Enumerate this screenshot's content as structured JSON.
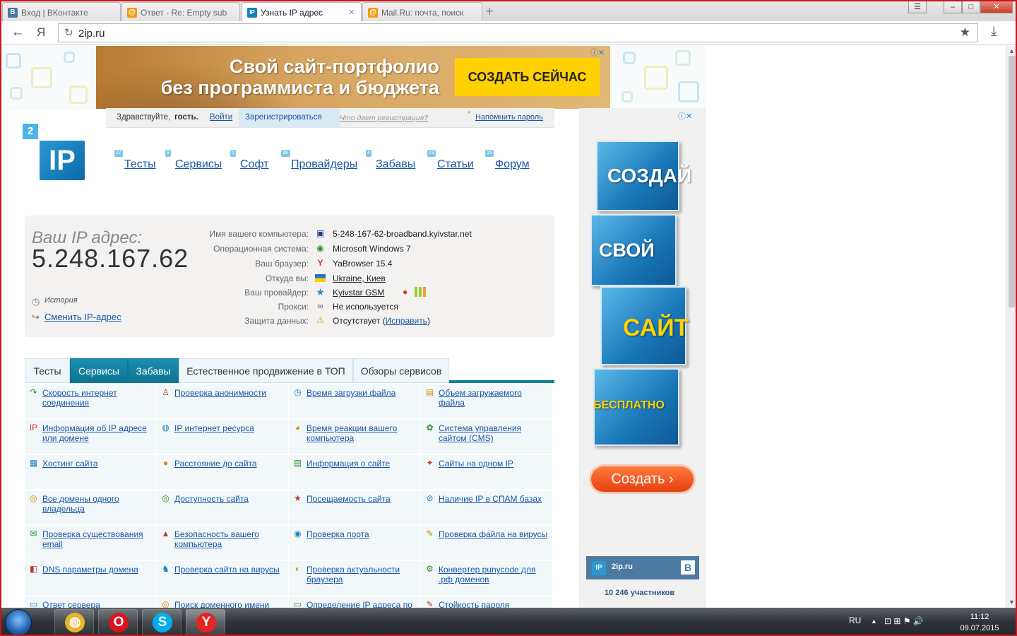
{
  "browser": {
    "tabs": [
      {
        "title": "Вход | ВКонтакте",
        "favicon": "В",
        "color": "#4c75a3"
      },
      {
        "title": "Ответ - Re: Empty sub",
        "favicon": "@",
        "color": "#f39c12"
      },
      {
        "title": "Узнать IP адрес",
        "favicon": "IP",
        "color": "#1a7fc1"
      },
      {
        "title": "Mail.Ru: почта, поиск",
        "favicon": "@",
        "color": "#f39c12"
      }
    ],
    "close_glyph": "×",
    "new_tab_glyph": "+",
    "url": "2ip.ru",
    "back_glyph": "←",
    "yandex_glyph": "Я",
    "reload_glyph": "↻",
    "star_glyph": "★",
    "download_glyph": "⤓",
    "win_menu": "☰",
    "win_min": "–",
    "win_max": "□",
    "win_close": "✕"
  },
  "banner": {
    "line1": "Свой сайт-портфолио",
    "line2": "без программиста и бюджета",
    "cta": "СОЗДАТЬ СЕЙЧАС",
    "ad_icons": "ⓘ✕"
  },
  "greet": {
    "hello": "Здравствуйте,",
    "guest": "гость.",
    "login": "Войти",
    "register": "Зарегистрироваться",
    "what": "Что дает регистрация?",
    "remind": "Напомнить пароль",
    "asterisk": "*"
  },
  "logo": {
    "badge": "2",
    "text": "IP"
  },
  "nav": [
    {
      "label": "Тесты",
      "badge": "27"
    },
    {
      "label": "Сервисы",
      "badge": "9"
    },
    {
      "label": "Софт",
      "badge": "5"
    },
    {
      "label": "Провайдеры",
      "badge": "2K"
    },
    {
      "label": "Забавы",
      "badge": "4"
    },
    {
      "label": "Статьи",
      "badge": "13"
    },
    {
      "label": "Форум",
      "badge": "15"
    }
  ],
  "ipinfo": {
    "label": "Ваш IP адрес:",
    "ip": "5.248.167.62",
    "history": "История",
    "change": "Сменить IP-адрес",
    "rows": [
      {
        "label": "Имя вашего компьютера:",
        "value": "5-248-167-62-broadband.kyivstar.net",
        "icon": "▣"
      },
      {
        "label": "Операционная система:",
        "value": "Microsoft Windows 7",
        "icon": "◉"
      },
      {
        "label": "Ваш браузер:",
        "value": "YaBrowser 15.4",
        "icon": "Y"
      },
      {
        "label": "Откуда вы:",
        "value": "Ukraine, Киев",
        "icon": "▬"
      },
      {
        "label": "Ваш провайдер:",
        "value": "Kyivstar GSM",
        "icon": "★"
      },
      {
        "label": "Прокси:",
        "value": "Не используется",
        "icon": "∞"
      },
      {
        "label": "Защита данных:",
        "value": "Отсутствует (",
        "icon": "⚠",
        "fix": "Исправить",
        "close": ")"
      }
    ]
  },
  "section_tabs": [
    {
      "label": "Тесты"
    },
    {
      "label": "Сервисы"
    },
    {
      "label": "Забавы"
    },
    {
      "label": "Естественное продвижение в ТОП"
    },
    {
      "label": "Обзоры сервисов"
    }
  ],
  "services": [
    [
      "Скорость интернет соединения",
      "Проверка анонимности",
      "Время загрузки файла",
      "Объем загружаемого файла"
    ],
    [
      "Информация об IP адресе или домене",
      "IP интернет ресурса",
      "Время реакции вашего компьютера",
      "Система управления сайтом (CMS)"
    ],
    [
      "Хостинг сайта",
      "Расстояние до сайта",
      "Информация о сайте",
      "Сайты на одном IP"
    ],
    [
      "Все домены одного владельца",
      "Доступность сайта",
      "Посещаемость сайта",
      "Наличие IP в СПАМ базах"
    ],
    [
      "Проверка существования email",
      "Безопасность вашего компьютера",
      "Проверка порта",
      "Проверка файла на вирусы"
    ],
    [
      "DNS параметры домена",
      "Проверка сайта на вирусы",
      "Проверка актуальности браузера",
      "Конвертер punycode для .рф доменов"
    ],
    [
      "Ответ сервера",
      "Поиск доменного имени",
      "Определение IP адреса по",
      "Стойкость пароля"
    ]
  ],
  "service_icons": [
    [
      "↷",
      "♙",
      "◷",
      "▤"
    ],
    [
      "IP",
      "◍",
      "◕",
      "✿"
    ],
    [
      "▦",
      "●",
      "▤",
      "✦"
    ],
    [
      "◎",
      "◎",
      "★",
      "⊘"
    ],
    [
      "✉",
      "▲",
      "◉",
      "✎"
    ],
    [
      "◧",
      "♞",
      "◐",
      "⚙"
    ],
    [
      "▭",
      "◎",
      "▭",
      "✎"
    ]
  ],
  "sidead": {
    "words": [
      "СОЗДАЙ",
      "СВОЙ",
      "САЙТ",
      "БЕСПЛАТНО"
    ],
    "button": "Создать ›",
    "ad_icons": "ⓘ✕",
    "vk_logo": "IP",
    "vk_name": "2ip.ru",
    "vk_b": "B",
    "vk_count": "10 246 участников"
  },
  "taskbar": {
    "lang": "RU",
    "tray_up": "▲",
    "tray_icons": "⊡ ⊞ ⚑ 🔊",
    "time": "11:12",
    "date": "09.07.2015",
    "apps": [
      {
        "glyph": "◍",
        "color": "#e8b42a"
      },
      {
        "glyph": "O",
        "color": "#d9161f"
      },
      {
        "glyph": "S",
        "color": "#00aff0"
      },
      {
        "glyph": "Y",
        "color": "#e52620"
      }
    ]
  },
  "colors": {
    "accent": "#10819a",
    "link": "#1a55a5",
    "frame": "#c8151b"
  }
}
